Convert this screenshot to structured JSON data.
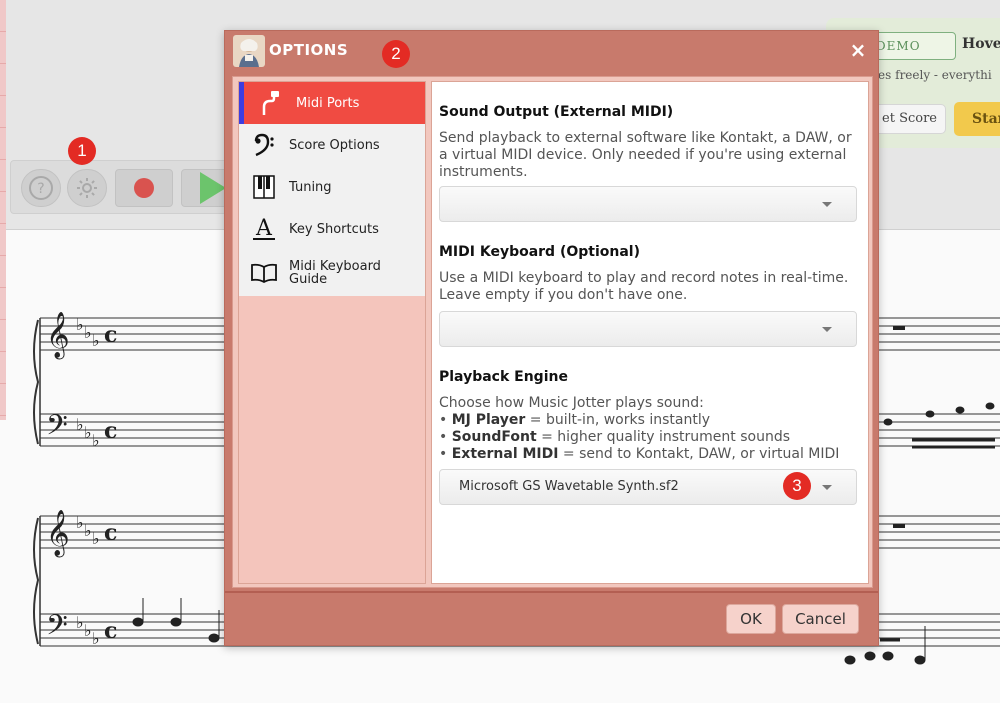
{
  "background": {
    "demo": {
      "badge": "E DEMO",
      "hover_text": "Hover",
      "subtitle": "otes freely - everythi",
      "reset_label": "et Score",
      "start_label": "Star"
    },
    "markers": [
      "1",
      "2",
      "3"
    ]
  },
  "dialog": {
    "title": "OPTIONS",
    "close_symbol": "×",
    "nav": [
      {
        "label": "Midi Ports",
        "icon": "midi-cable-icon",
        "active": true
      },
      {
        "label": "Score Options",
        "icon": "bass-clef-icon",
        "active": false
      },
      {
        "label": "Tuning",
        "icon": "piano-keys-icon",
        "active": false
      },
      {
        "label": "Key Shortcuts",
        "icon": "keyboard-letter-icon",
        "active": false
      },
      {
        "label": "Midi Keyboard Guide",
        "icon": "open-book-icon",
        "active": false
      }
    ],
    "sections": {
      "sound_output": {
        "title": "Sound Output (External MIDI)",
        "description": "Send playback to external software like Kontakt, a DAW, or a virtual MIDI device. Only needed if you're using external instruments.",
        "selected": ""
      },
      "midi_keyboard": {
        "title": "MIDI Keyboard (Optional)",
        "description": "Use a MIDI keyboard to play and record notes in real-time. Leave empty if you don't have one.",
        "selected": ""
      },
      "playback_engine": {
        "title": "Playback Engine",
        "description": "Choose how Music Jotter plays sound:",
        "bullets": [
          {
            "term": "MJ Player",
            "text": " = built-in, works instantly"
          },
          {
            "term": "SoundFont",
            "text": " = higher quality instrument sounds"
          },
          {
            "term": "External MIDI",
            "text": " = send to Kontakt, DAW, or virtual MIDI"
          }
        ],
        "bullet_symbol": "•",
        "selected": "Microsoft GS Wavetable Synth.sf2"
      }
    },
    "ok_label": "OK",
    "cancel_label": "Cancel"
  },
  "colors": {
    "dialog_frame": "#c87a6c",
    "active_nav": "#f04b42",
    "active_nav_accent": "#3d3de0",
    "marker": "#e32b24"
  }
}
